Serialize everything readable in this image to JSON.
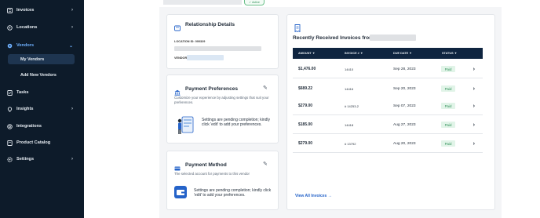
{
  "sidebar": {
    "items": [
      {
        "label": "Invoices",
        "icon": "invoice-icon",
        "chevron": "›"
      },
      {
        "label": "Locations",
        "icon": "location-icon",
        "chevron": "›"
      },
      {
        "label": "Vendors",
        "icon": "vendor-icon",
        "chevron": "⌄"
      },
      {
        "label": "Tasks",
        "icon": "tasks-icon",
        "chevron": ""
      },
      {
        "label": "Insights",
        "icon": "insights-icon",
        "chevron": "›"
      },
      {
        "label": "Integrations",
        "icon": "integrations-icon",
        "chevron": ""
      },
      {
        "label": "Product Catalog",
        "icon": "catalog-icon",
        "chevron": ""
      },
      {
        "label": "Settings",
        "icon": "settings-icon",
        "chevron": "›"
      }
    ],
    "sub_items": [
      {
        "label": "My Vendors",
        "active": true
      },
      {
        "label": "Add New Vendors",
        "active": false
      }
    ]
  },
  "header": {
    "status_pill": "Active"
  },
  "relationship": {
    "title": "Relationship Details",
    "location_label": "LOCATION ID: 000329",
    "vendor_label": "VENDOR:"
  },
  "payment_preferences": {
    "title": "Payment Preferences",
    "description": "Customize your experience by adjusting settings that suit your preferences.",
    "note": "Settings are pending completion; kindly click 'edit' to add your preferences."
  },
  "payment_method": {
    "title": "Payment Method",
    "description": "The selected account for payments to this vendor",
    "note": "Settings are pending completion; kindly click 'edit' to add your preferences."
  },
  "invoices": {
    "title": "Recently Received Invoices from",
    "columns": [
      "AMOUNT ▼",
      "INVOICE # ▼",
      "DUE DATE ▼",
      "STATUS ▼"
    ],
    "rows": [
      {
        "amount": "$1,476.00",
        "invoice": "14410",
        "due": "Sep 28, 2023",
        "status": "Paid"
      },
      {
        "amount": "$689.22",
        "invoice": "14416",
        "due": "Sep 20, 2023",
        "status": "Paid"
      },
      {
        "amount": "$279.00",
        "invoice": "# 14253-2",
        "due": "Sep 07, 2023",
        "status": "Paid"
      },
      {
        "amount": "$185.00",
        "invoice": "14418",
        "due": "Aug 27, 2023",
        "status": "Paid"
      },
      {
        "amount": "$279.00",
        "invoice": "# 13792",
        "due": "Aug 20, 2023",
        "status": "Paid"
      }
    ],
    "view_all": "View All Invoices →"
  },
  "colors": {
    "sidebar_bg": "#0d1b2a",
    "table_header_bg": "#0f2540",
    "paid_bg": "#e1f4e8",
    "paid_text": "#2f8f57",
    "accent": "#2563c9"
  }
}
